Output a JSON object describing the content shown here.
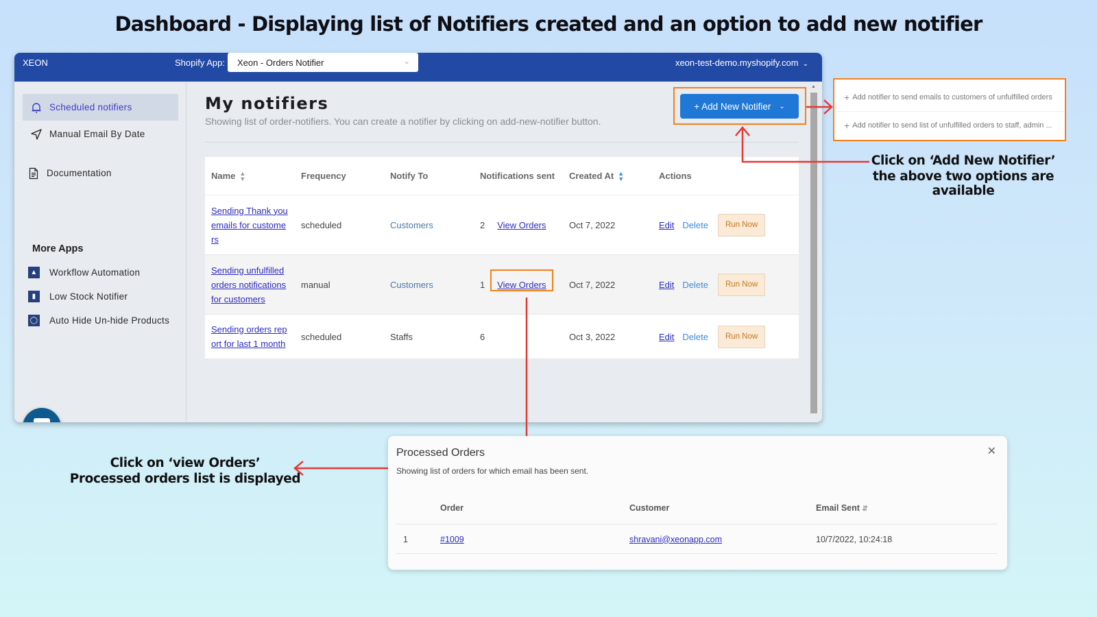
{
  "page_title": "Dashboard - Displaying list of Notifiers created and an option to add new notifier",
  "topbar": {
    "brand": "XEON",
    "app_label": "Shopify App:",
    "app_select_value": "Xeon - Orders Notifier",
    "store": "xeon-test-demo.myshopify.com"
  },
  "sidebar": {
    "items": [
      {
        "label": "Scheduled notifiers",
        "icon": "bell-icon",
        "active": true
      },
      {
        "label": "Manual Email By Date",
        "icon": "send-icon",
        "active": false
      },
      {
        "label": "Documentation",
        "icon": "document-icon",
        "active": false
      }
    ],
    "more_apps_title": "More Apps",
    "more_apps": [
      {
        "label": "Workflow Automation",
        "icon": "workflow-app-icon"
      },
      {
        "label": "Low Stock Notifier",
        "icon": "low-stock-app-icon"
      },
      {
        "label": "Auto Hide Un-hide Products",
        "icon": "auto-hide-app-icon"
      }
    ]
  },
  "main": {
    "title": "My notifiers",
    "subtitle": "Showing list of order-notifiers. You can create a notifier by clicking on add-new-notifier button.",
    "add_button": "+ Add New Notifier",
    "columns": [
      "Name",
      "Frequency",
      "Notify To",
      "Notifications sent",
      "Created At",
      "Actions"
    ],
    "rows": [
      {
        "name": "Sending Thank you emails for custome rs",
        "frequency": "scheduled",
        "notify_to": "Customers",
        "sent": "2",
        "view_link": "View Orders",
        "created": "Oct 7, 2022"
      },
      {
        "name": "Sending unfulfilled orders notifications for customers",
        "frequency": "manual",
        "notify_to": "Customers",
        "sent": "1",
        "view_link": "View Orders",
        "created": "Oct 7, 2022"
      },
      {
        "name": "Sending orders rep ort for last 1 month",
        "frequency": "scheduled",
        "notify_to": "Staffs",
        "sent": "6",
        "view_link": "",
        "created": "Oct 3, 2022"
      }
    ],
    "actions": {
      "edit": "Edit",
      "delete": "Delete",
      "run_now": "Run Now"
    }
  },
  "dropdown": {
    "options": [
      "Add notifier to send emails to customers of unfulfilled orders",
      "Add notifier to send list of unfulfilled orders to staff, admin ..."
    ]
  },
  "annotations": {
    "add_notifier_line1": "Click on ‘Add New Notifier’",
    "add_notifier_line2": "the above two options are available",
    "view_orders_line1": "Click on ‘view Orders’",
    "view_orders_line2": "Processed orders list is displayed"
  },
  "modal": {
    "title": "Processed Orders",
    "subtitle": "Showing list of orders for which email has been sent.",
    "columns": [
      "Order",
      "Customer",
      "Email Sent"
    ],
    "rows": [
      {
        "index": "1",
        "order": "#1009",
        "customer": "shravani@xeonapp.com",
        "email_sent": "10/7/2022, 10:24:18"
      }
    ]
  },
  "colors": {
    "brand_blue": "#2249a3",
    "button_blue": "#1f77d6",
    "highlight_orange": "#f57f17",
    "arrow_red": "#e53935"
  }
}
